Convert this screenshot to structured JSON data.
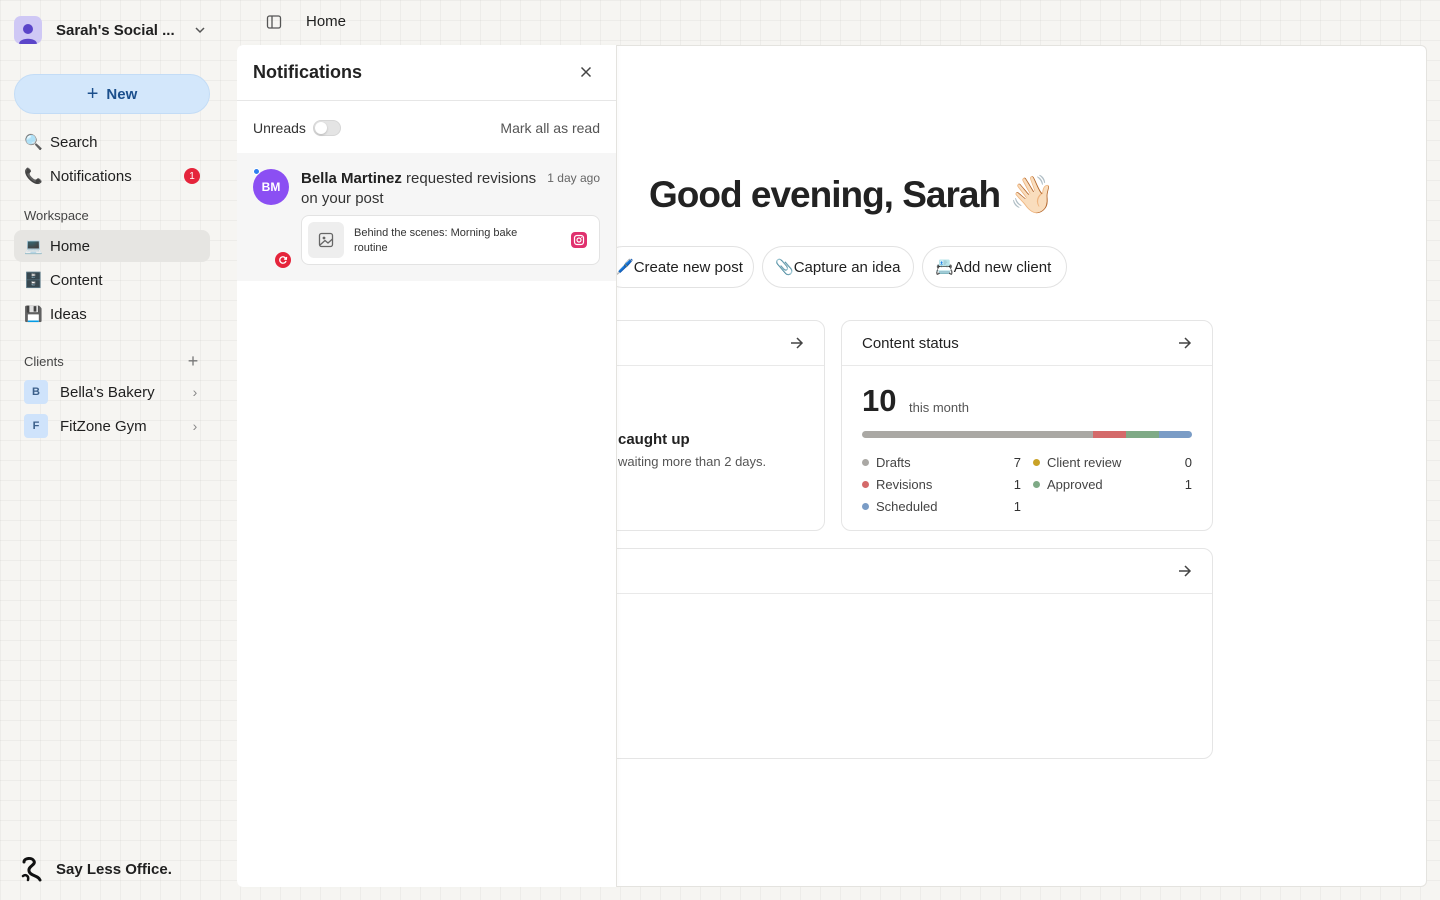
{
  "workspace": {
    "name": "Sarah's Social ..."
  },
  "sidebar": {
    "new_label": "New",
    "nav": [
      {
        "label": "Search",
        "icon": "magnifying-glass",
        "emoji": "🔍"
      },
      {
        "label": "Notifications",
        "icon": "telephone",
        "emoji": "📞",
        "badge": "1"
      }
    ],
    "workspace_label": "Workspace",
    "workspace_items": [
      {
        "label": "Home",
        "icon": "laptop",
        "emoji": "💻",
        "active": true
      },
      {
        "label": "Content",
        "icon": "file-cabinet",
        "emoji": "🗄️"
      },
      {
        "label": "Ideas",
        "icon": "floppy-disk",
        "emoji": "💾"
      }
    ],
    "clients_label": "Clients",
    "clients": [
      {
        "initial": "B",
        "name": "Bella's Bakery"
      },
      {
        "initial": "F",
        "name": "FitZone Gym"
      }
    ],
    "brand": "Say Less Office."
  },
  "topbar": {
    "breadcrumb": "Home"
  },
  "main": {
    "greeting": "Good evening, Sarah 👋🏻",
    "quick_actions": [
      {
        "emoji": "🖊️",
        "label": "Create new post"
      },
      {
        "emoji": "📎",
        "label": "Capture an idea"
      },
      {
        "emoji": "📇",
        "label": "Add new client"
      }
    ],
    "left_card": {
      "title": "caught up",
      "subtitle": "waiting more than 2 days."
    },
    "content_status": {
      "title": "Content status",
      "count": "10",
      "count_label": "this month",
      "items": [
        {
          "label": "Drafts",
          "value": "7",
          "color": "#aaa8a4"
        },
        {
          "label": "Client review",
          "value": "0",
          "color": "#c9a227"
        },
        {
          "label": "Revisions",
          "value": "1",
          "color": "#d46a6a"
        },
        {
          "label": "Approved",
          "value": "1",
          "color": "#7faa86"
        },
        {
          "label": "Scheduled",
          "value": "1",
          "color": "#7a9cc6"
        }
      ]
    }
  },
  "notifications": {
    "title": "Notifications",
    "unreads_label": "Unreads",
    "unreads_on": false,
    "mark_all": "Mark all as read",
    "items": [
      {
        "avatar": "BM",
        "actor": "Bella Martinez",
        "action": " requested revisions on your post",
        "time": "1 day ago",
        "post_title": "Behind the scenes: Morning bake routine",
        "platform": "instagram",
        "unread": true
      }
    ]
  }
}
